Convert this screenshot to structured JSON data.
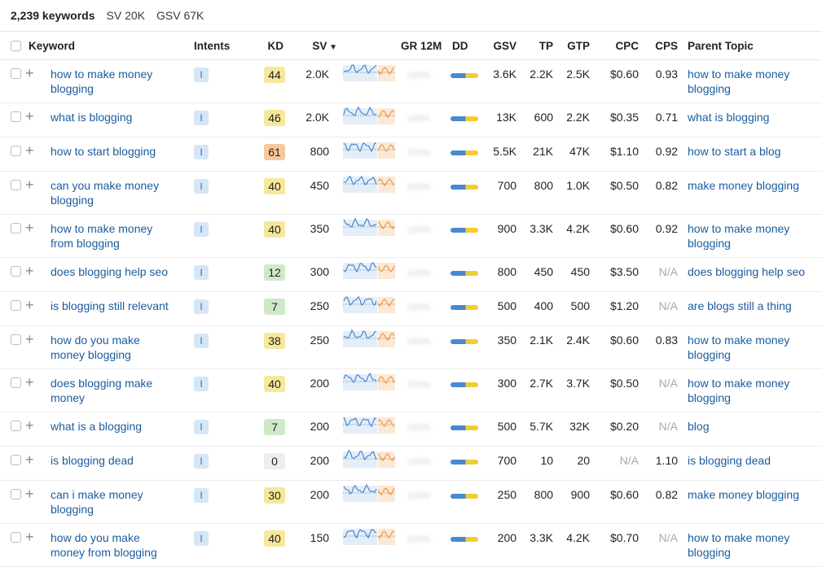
{
  "summary": {
    "keywords": "2,239 keywords",
    "sv": "SV 20K",
    "gsv": "GSV 67K"
  },
  "headers": {
    "keyword": "Keyword",
    "intents": "Intents",
    "kd": "KD",
    "sv": "SV",
    "gr": "GR 12M",
    "dd": "DD",
    "gsv": "GSV",
    "tp": "TP",
    "gtp": "GTP",
    "cpc": "CPC",
    "cps": "CPS",
    "parent": "Parent Topic"
  },
  "icons": {
    "plus": "plus-icon",
    "sort": "sort-down-icon"
  },
  "colors": {
    "link": "#1a5c9e",
    "kd_low": "#cfe9c8",
    "kd_mid": "#f7e79a",
    "kd_high": "#f8c79a",
    "kd_zero": "#eeeeee",
    "spark_blue": "#4a88d0",
    "spark_orange": "#ef9a3c"
  },
  "rows": [
    {
      "keyword": [
        "how to make money",
        "blogging"
      ],
      "intent": "I",
      "kd": "44",
      "sv": "2.0K",
      "gr": "100%",
      "gsv": "3.6K",
      "tp": "2.2K",
      "gtp": "2.5K",
      "cpc": "$0.60",
      "cps": "0.93",
      "parent": [
        "how to make money",
        "blogging"
      ]
    },
    {
      "keyword": [
        "what is blogging"
      ],
      "intent": "I",
      "kd": "46",
      "sv": "2.0K",
      "gr": "100%",
      "gsv": "13K",
      "tp": "600",
      "gtp": "2.2K",
      "cpc": "$0.35",
      "cps": "0.71",
      "parent": [
        "what is blogging"
      ]
    },
    {
      "keyword": [
        "how to start blogging"
      ],
      "intent": "I",
      "kd": "61",
      "sv": "800",
      "gr": "100%",
      "gsv": "5.5K",
      "tp": "21K",
      "gtp": "47K",
      "cpc": "$1.10",
      "cps": "0.92",
      "parent": [
        "how to start a blog"
      ]
    },
    {
      "keyword": [
        "can you make money",
        "blogging"
      ],
      "intent": "I",
      "kd": "40",
      "sv": "450",
      "gr": "100%",
      "gsv": "700",
      "tp": "800",
      "gtp": "1.0K",
      "cpc": "$0.50",
      "cps": "0.82",
      "parent": [
        "make money blogging"
      ]
    },
    {
      "keyword": [
        "how to make money",
        "from blogging"
      ],
      "intent": "I",
      "kd": "40",
      "sv": "350",
      "gr": "100%",
      "gsv": "900",
      "tp": "3.3K",
      "gtp": "4.2K",
      "cpc": "$0.60",
      "cps": "0.92",
      "parent": [
        "how to make money",
        "blogging"
      ]
    },
    {
      "keyword": [
        "does blogging help seo"
      ],
      "intent": "I",
      "kd": "12",
      "sv": "300",
      "gr": "100%",
      "gsv": "800",
      "tp": "450",
      "gtp": "450",
      "cpc": "$3.50",
      "cps": "N/A",
      "parent": [
        "does blogging help seo"
      ]
    },
    {
      "keyword": [
        "is blogging still relevant"
      ],
      "intent": "I",
      "kd": "7",
      "sv": "250",
      "gr": "100%",
      "gsv": "500",
      "tp": "400",
      "gtp": "500",
      "cpc": "$1.20",
      "cps": "N/A",
      "parent": [
        "are blogs still a thing"
      ]
    },
    {
      "keyword": [
        "how do you make",
        "money blogging"
      ],
      "intent": "I",
      "kd": "38",
      "sv": "250",
      "gr": "100%",
      "gsv": "350",
      "tp": "2.1K",
      "gtp": "2.4K",
      "cpc": "$0.60",
      "cps": "0.83",
      "parent": [
        "how to make money",
        "blogging"
      ]
    },
    {
      "keyword": [
        "does blogging make",
        "money"
      ],
      "intent": "I",
      "kd": "40",
      "sv": "200",
      "gr": "100%",
      "gsv": "300",
      "tp": "2.7K",
      "gtp": "3.7K",
      "cpc": "$0.50",
      "cps": "N/A",
      "parent": [
        "how to make money",
        "blogging"
      ]
    },
    {
      "keyword": [
        "what is a blogging"
      ],
      "intent": "I",
      "kd": "7",
      "sv": "200",
      "gr": "100%",
      "gsv": "500",
      "tp": "5.7K",
      "gtp": "32K",
      "cpc": "$0.20",
      "cps": "N/A",
      "parent": [
        "blog"
      ]
    },
    {
      "keyword": [
        "is blogging dead"
      ],
      "intent": "I",
      "kd": "0",
      "sv": "200",
      "gr": "100%",
      "gsv": "700",
      "tp": "10",
      "gtp": "20",
      "cpc": "N/A",
      "cps": "1.10",
      "parent": [
        "is blogging dead"
      ]
    },
    {
      "keyword": [
        "can i make money",
        "blogging"
      ],
      "intent": "I",
      "kd": "30",
      "sv": "200",
      "gr": "100%",
      "gsv": "250",
      "tp": "800",
      "gtp": "900",
      "cpc": "$0.60",
      "cps": "0.82",
      "parent": [
        "make money blogging"
      ]
    },
    {
      "keyword": [
        "how do you make",
        "money from blogging"
      ],
      "intent": "I",
      "kd": "40",
      "sv": "150",
      "gr": "100%",
      "gsv": "200",
      "tp": "3.3K",
      "gtp": "4.2K",
      "cpc": "$0.70",
      "cps": "N/A",
      "parent": [
        "how to make money",
        "blogging"
      ]
    }
  ]
}
